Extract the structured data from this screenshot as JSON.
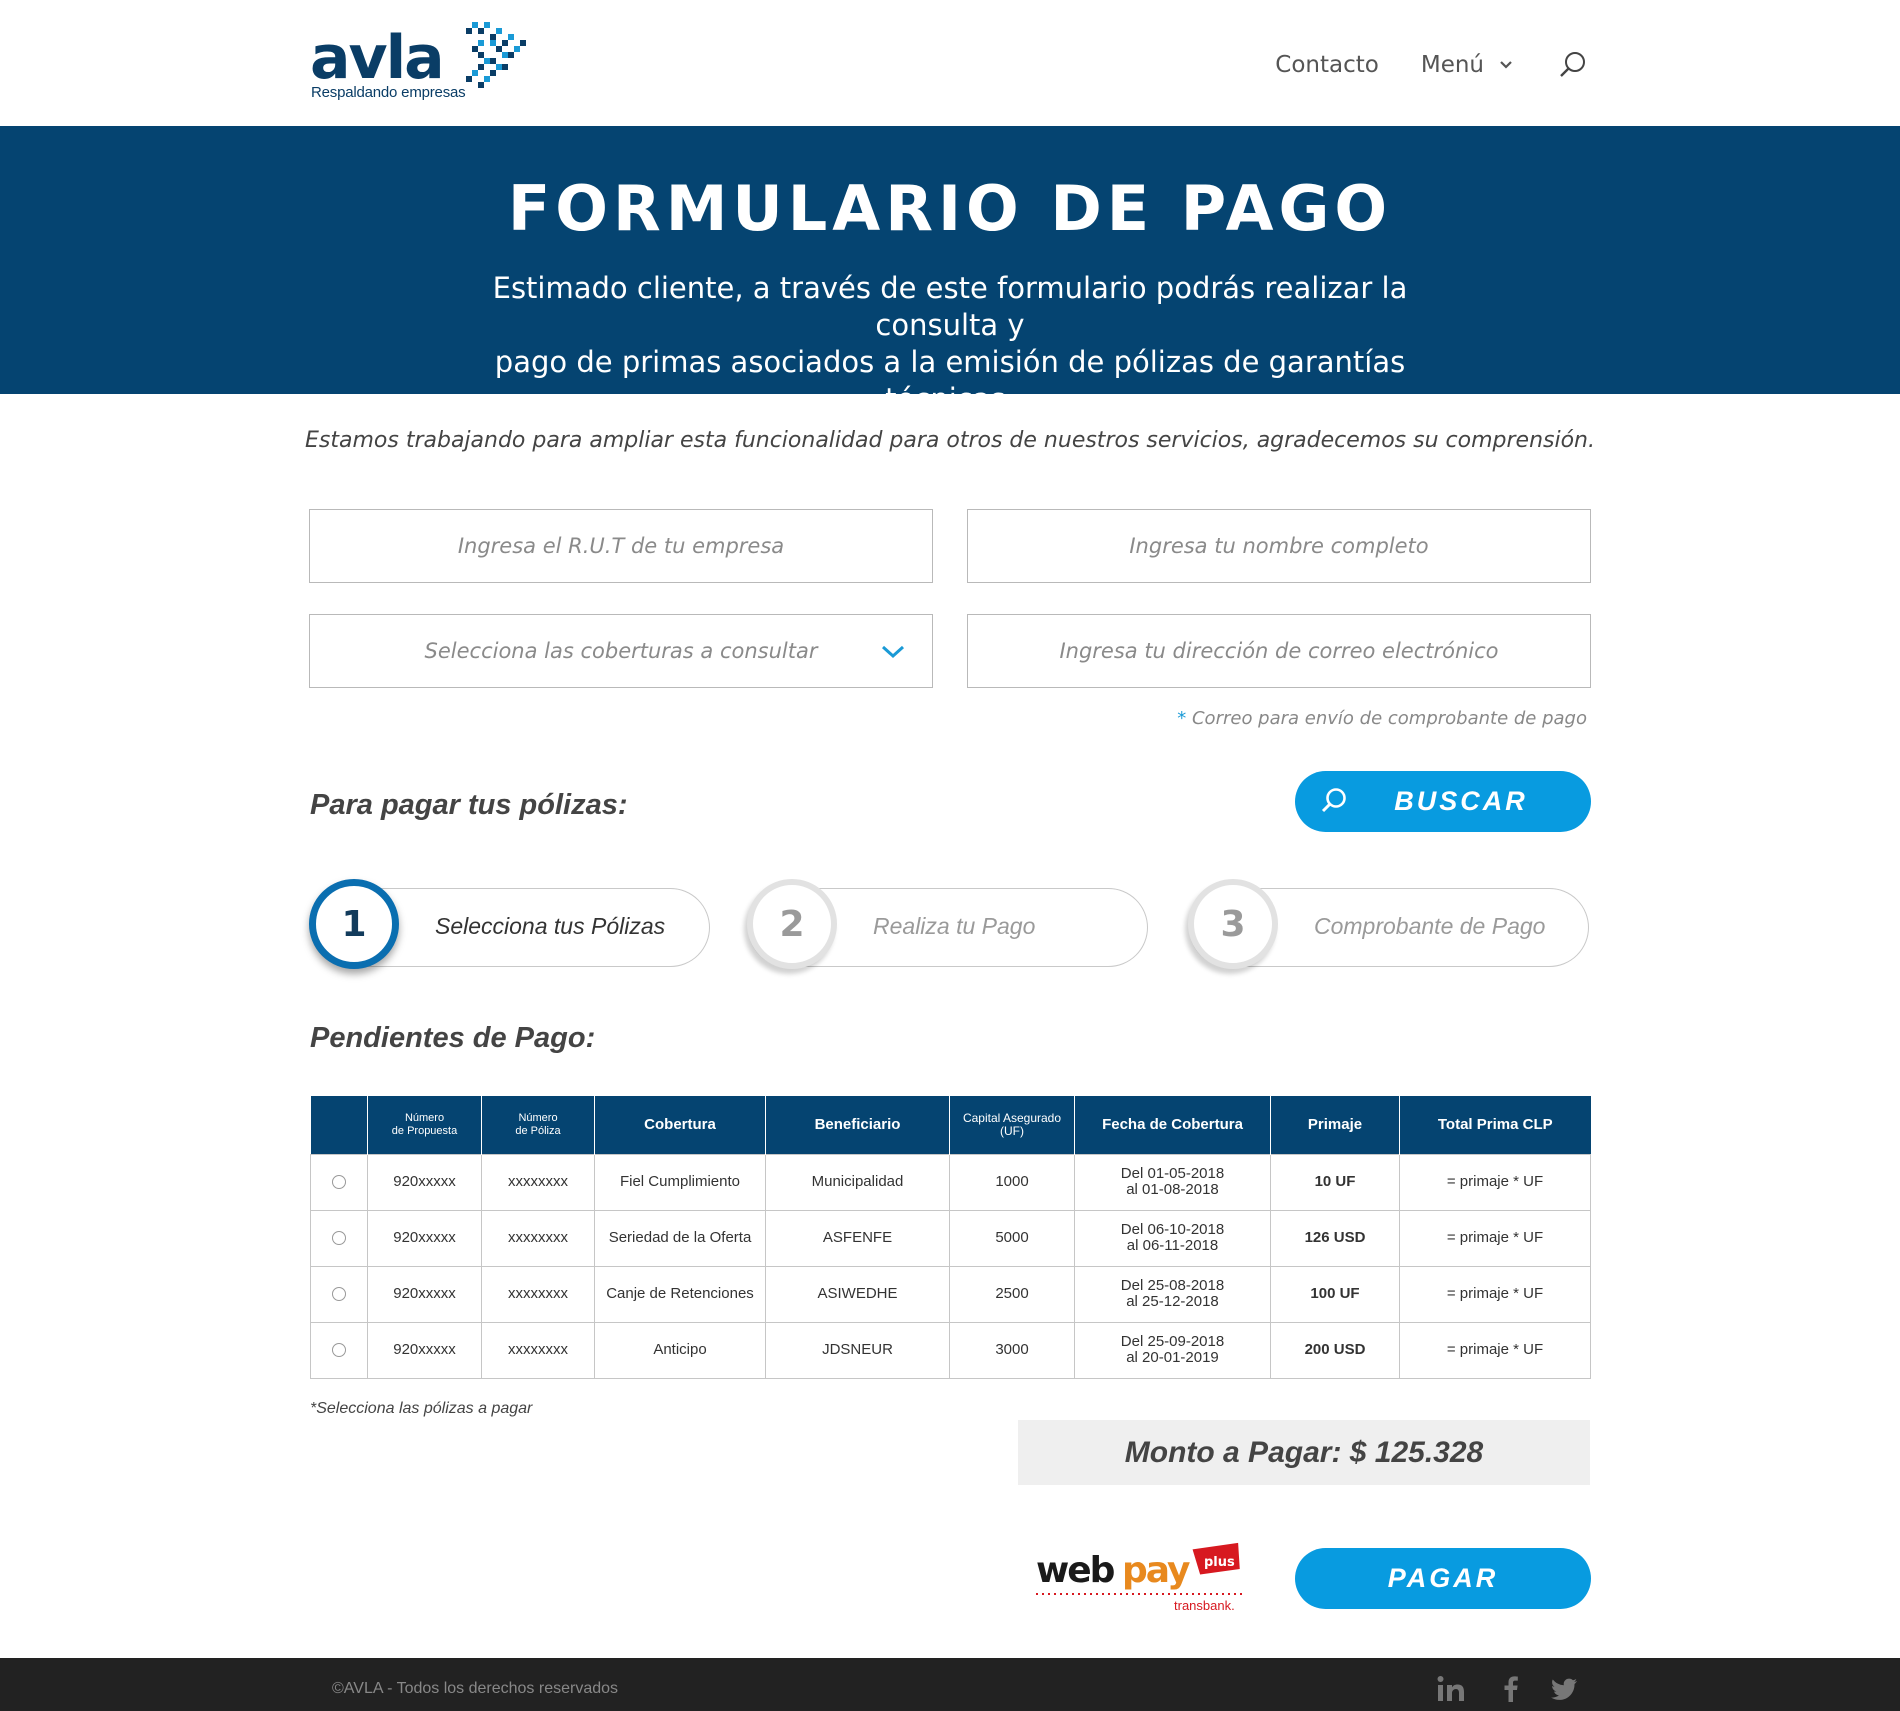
{
  "header": {
    "logo_text": "avla",
    "logo_tagline": "Respaldando empresas",
    "nav": {
      "contacto": "Contacto",
      "menu": "Menú"
    }
  },
  "hero": {
    "title": "FORMULARIO DE PAGO",
    "subtitle_line1": "Estimado cliente, a través de este formulario podrás realizar la consulta y",
    "subtitle_line2": "pago de primas asociados a la emisión de pólizas de garantías técnicas."
  },
  "notice": "Estamos trabajando para ampliar esta funcionalidad para otros de nuestros servicios, agradecemos su comprensión.",
  "form": {
    "rut_placeholder": "Ingresa el R.U.T de tu empresa",
    "name_placeholder": "Ingresa tu nombre completo",
    "coverage_select": "Selecciona las coberturas a consultar",
    "email_placeholder": "Ingresa tu dirección de correo electrónico",
    "email_note_marker": "*",
    "email_note": "Correo para envío de comprobante de pago",
    "search_label": "BUSCAR"
  },
  "steps": {
    "section_title": "Para pagar tus pólizas:",
    "items": [
      {
        "number": "1",
        "label": "Selecciona tus Pólizas"
      },
      {
        "number": "2",
        "label": "Realiza tu Pago"
      },
      {
        "number": "3",
        "label": "Comprobante de Pago"
      }
    ]
  },
  "pending": {
    "title": "Pendientes de Pago:",
    "columns": {
      "propuesta_1": "Número",
      "propuesta_2": "de Propuesta",
      "poliza_1": "Número",
      "poliza_2": "de Póliza",
      "cobertura": "Cobertura",
      "beneficiario": "Beneficiario",
      "capital_1": "Capital Asegurado",
      "capital_2": "(UF)",
      "fecha": "Fecha de Cobertura",
      "primaje": "Primaje",
      "total": "Total Prima CLP"
    },
    "rows": [
      {
        "propuesta": "920xxxxx",
        "poliza": "xxxxxxxx",
        "cobertura": "Fiel Cumplimiento",
        "beneficiario": "Municipalidad",
        "capital": "1000",
        "fecha_1": "Del 01-05-2018",
        "fecha_2": "al 01-08-2018",
        "primaje": "10 UF",
        "total": "= primaje * UF"
      },
      {
        "propuesta": "920xxxxx",
        "poliza": "xxxxxxxx",
        "cobertura": "Seriedad de la Oferta",
        "beneficiario": "ASFENFE",
        "capital": "5000",
        "fecha_1": "Del 06-10-2018",
        "fecha_2": "al 06-11-2018",
        "primaje": "126 USD",
        "total": "= primaje * UF"
      },
      {
        "propuesta": "920xxxxx",
        "poliza": "xxxxxxxx",
        "cobertura": "Canje de Retenciones",
        "beneficiario": "ASIWEDHE",
        "capital": "2500",
        "fecha_1": "Del 25-08-2018",
        "fecha_2": "al 25-12-2018",
        "primaje": "100 UF",
        "total": "= primaje * UF"
      },
      {
        "propuesta": "920xxxxx",
        "poliza": "xxxxxxxx",
        "cobertura": "Anticipo",
        "beneficiario": "JDSNEUR",
        "capital": "3000",
        "fecha_1": "Del 25-09-2018",
        "fecha_2": "al 20-01-2019",
        "primaje": "200 USD",
        "total": "= primaje * UF"
      }
    ],
    "select_note": "*Selecciona las pólizas a pagar",
    "amount_label": "Monto a Pagar: $ 125.328",
    "webpay_brand": "webpay",
    "webpay_plus": "plus",
    "webpay_sub": "transbank.",
    "pay_label": "PAGAR"
  },
  "footer": {
    "copyright": "©AVLA - Todos los derechos reservados",
    "social": [
      "linkedin-icon",
      "facebook-icon",
      "twitter-icon"
    ]
  },
  "colors": {
    "brand_navy": "#054471",
    "accent_blue": "#089be0",
    "footer": "#222222"
  }
}
